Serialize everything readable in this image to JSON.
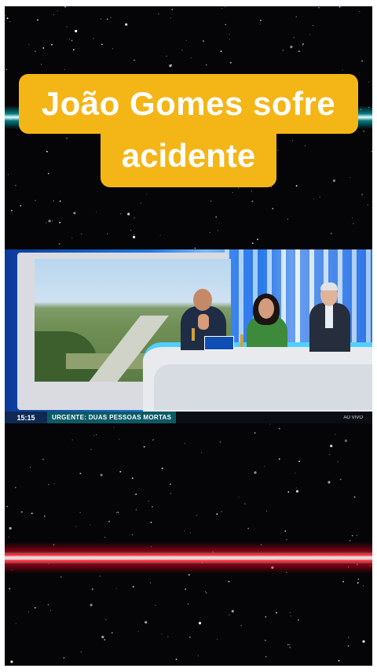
{
  "title": {
    "line1": "João Gomes sofre",
    "line2": "acidente"
  },
  "video": {
    "ticker_time": "15:15",
    "ticker_text": "URGENTE: DUAS PESSOAS MORTAS",
    "ticker_live": "AO VIVO"
  },
  "colors": {
    "title_bg": "#f4b517",
    "title_text": "#ffffff",
    "background": "#050507",
    "beam_top": "#00dce6",
    "beam_bottom": "#e6001e"
  }
}
